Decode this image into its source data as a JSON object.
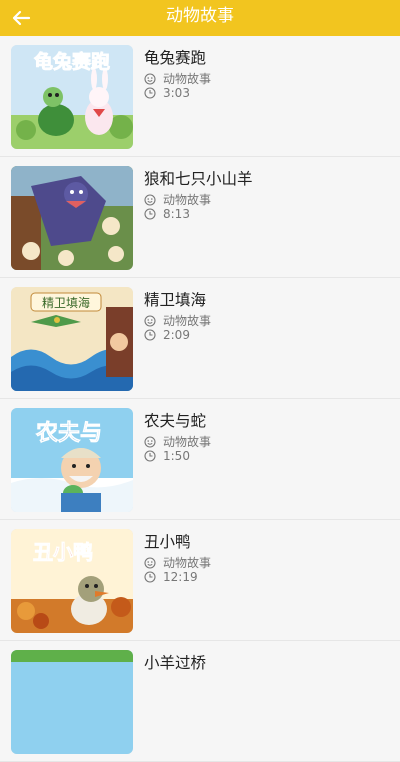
{
  "header": {
    "title": "动物故事",
    "back_icon": "arrow-left-icon",
    "background_color": "#f2c51f"
  },
  "stories": [
    {
      "title": "龟兔赛跑",
      "category": "动物故事",
      "duration": "3:03",
      "cover_text": "龟兔赛跑"
    },
    {
      "title": "狼和七只小山羊",
      "category": "动物故事",
      "duration": "8:13",
      "cover_text": ""
    },
    {
      "title": "精卫填海",
      "category": "动物故事",
      "duration": "2:09",
      "cover_text": "精卫填海"
    },
    {
      "title": "农夫与蛇",
      "category": "动物故事",
      "duration": "1:50",
      "cover_text": "农夫与"
    },
    {
      "title": "丑小鸭",
      "category": "动物故事",
      "duration": "12:19",
      "cover_text": "丑小鸭"
    },
    {
      "title": "小羊过桥",
      "category": "",
      "duration": "",
      "cover_text": ""
    }
  ],
  "icons": {
    "category": "face-icon",
    "duration": "clock-icon"
  }
}
